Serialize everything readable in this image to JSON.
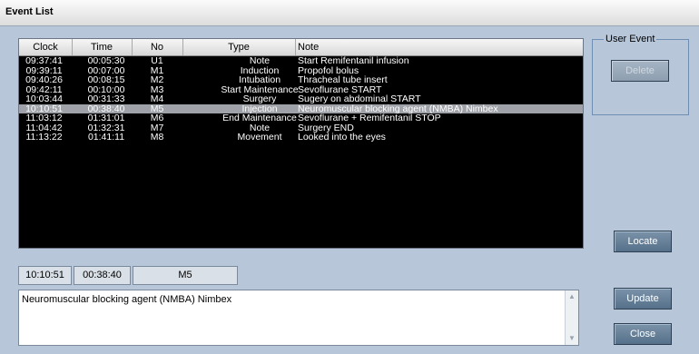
{
  "window": {
    "title": "Event List"
  },
  "columns": [
    "Clock",
    "Time",
    "No",
    "Type",
    "Note"
  ],
  "rows": [
    {
      "clock": "09:37:41",
      "time": "00:05:30",
      "no": "U1",
      "type": "Note",
      "note": "Start Remifentanil infusion"
    },
    {
      "clock": "09:39:11",
      "time": "00:07:00",
      "no": "M1",
      "type": "Induction",
      "note": "Propofol bolus"
    },
    {
      "clock": "09:40:26",
      "time": "00:08:15",
      "no": "M2",
      "type": "Intubation",
      "note": "Thracheal tube insert"
    },
    {
      "clock": "09:42:11",
      "time": "00:10:00",
      "no": "M3",
      "type": "Start Maintenance",
      "note": "Sevoflurane START"
    },
    {
      "clock": "10:03:44",
      "time": "00:31:33",
      "no": "M4",
      "type": "Surgery",
      "note": "Sugery on abdominal START"
    },
    {
      "clock": "10:10:51",
      "time": "00:38:40",
      "no": "M5",
      "type": "Injection",
      "note": "Neuromuscular blocking agent (NMBA) Nimbex"
    },
    {
      "clock": "11:03:12",
      "time": "01:31:01",
      "no": "M6",
      "type": "End Maintenance",
      "note": "Sevoflurane + Remifentanil STOP"
    },
    {
      "clock": "11:04:42",
      "time": "01:32:31",
      "no": "M7",
      "type": "Note",
      "note": "Surgery END"
    },
    {
      "clock": "11:13:22",
      "time": "01:41:11",
      "no": "M8",
      "type": "Movement",
      "note": "Looked into the eyes"
    }
  ],
  "selected_index": 5,
  "user_event": {
    "legend": "User Event",
    "delete_label": "Delete"
  },
  "buttons": {
    "locate": "Locate",
    "update": "Update",
    "close": "Close"
  },
  "selected": {
    "clock": "10:10:51",
    "time": "00:38:40",
    "no": "M5",
    "note": "Neuromuscular blocking agent (NMBA) Nimbex"
  }
}
